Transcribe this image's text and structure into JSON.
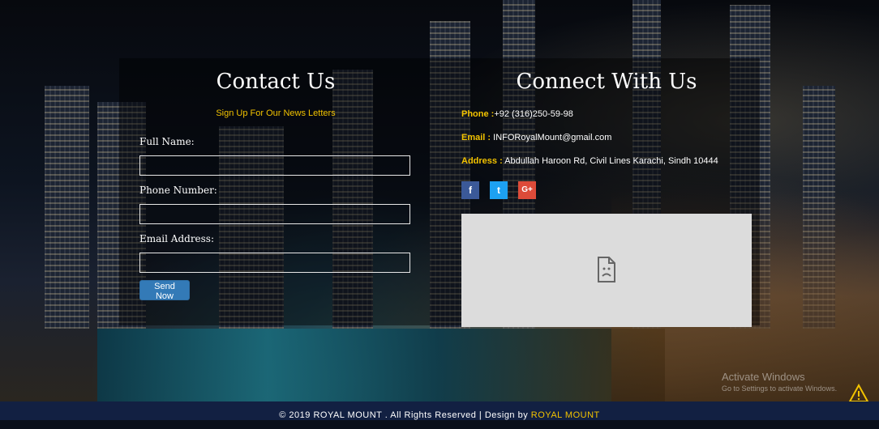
{
  "contact": {
    "title": "Contact Us",
    "subtitle": "Sign Up For Our News Letters",
    "full_name_label": "Full Name:",
    "full_name_value": "",
    "phone_label": "Phone Number:",
    "phone_value": "",
    "email_label": "Email Address:",
    "email_value": "",
    "send_button": "Send Now"
  },
  "connect": {
    "title": "Connect With Us",
    "phone_key": "Phone :",
    "phone_value": "+92 (316)250-59-98",
    "email_key": "Email :",
    "email_value": " INFORoyalMount@gmail.com",
    "address_key": "Address :",
    "address_value": " Abdullah Haroon Rd, Civil Lines Karachi, Sindh 10444",
    "social": [
      {
        "name": "facebook-icon",
        "glyph": "f",
        "color": "#3b5998"
      },
      {
        "name": "twitter-icon",
        "glyph": "t",
        "color": "#1da1f2"
      },
      {
        "name": "google-plus-icon",
        "glyph": "G+",
        "color": "#dd4b39"
      }
    ]
  },
  "watermark": {
    "line1": "Activate Windows",
    "line2": "Go to Settings to activate Windows."
  },
  "footer": {
    "copyright": "© 2019 ROYAL MOUNT . All Rights Reserved | Design by ",
    "brand": "ROYAL MOUNT"
  },
  "colors": {
    "accent": "#f3c300",
    "button": "#337ab7",
    "footer_bg": "#122042"
  }
}
